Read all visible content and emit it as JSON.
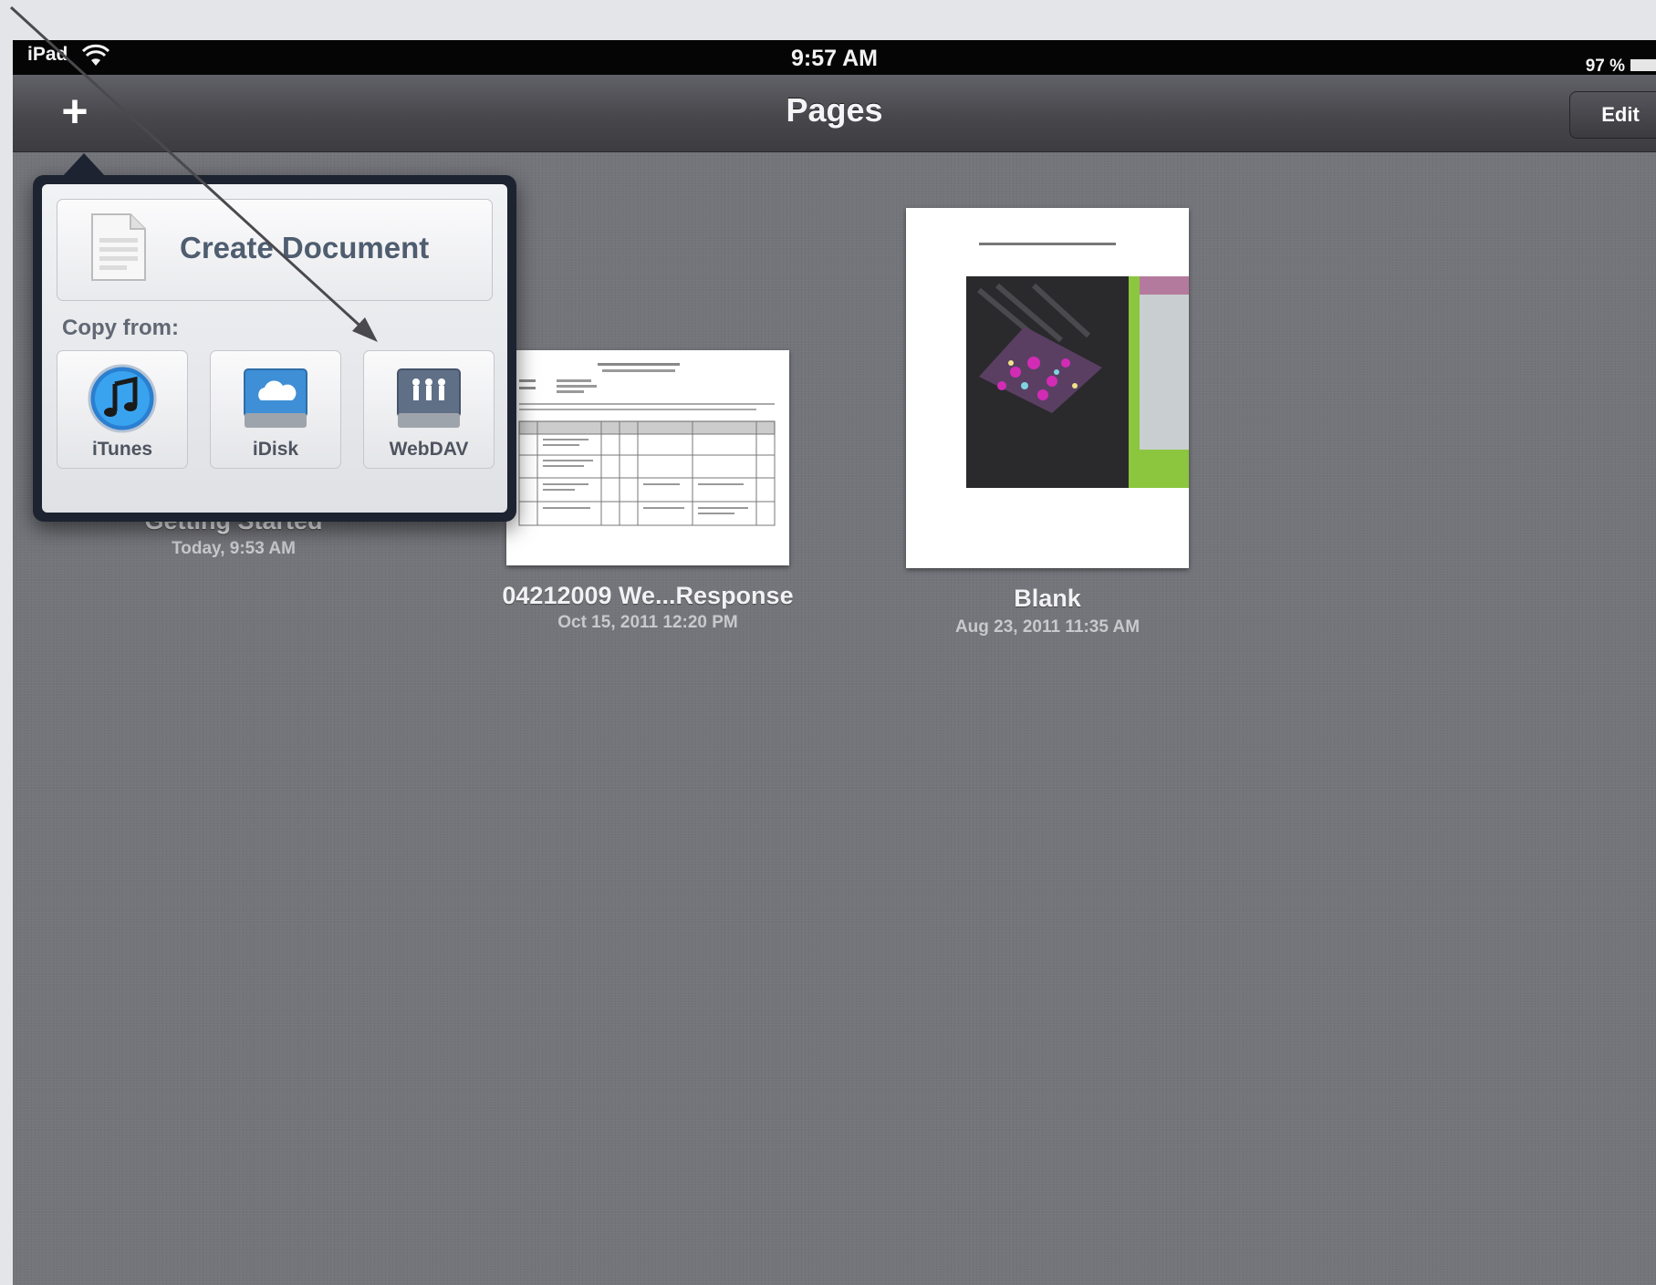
{
  "status_bar": {
    "carrier": "iPad",
    "time": "9:57 AM",
    "battery": "97 %"
  },
  "nav": {
    "title": "Pages",
    "add_label": "+",
    "edit_label": "Edit"
  },
  "popover": {
    "create_label": "Create Document",
    "copy_from_label": "Copy from:",
    "sources": [
      {
        "label": "iTunes",
        "icon": "itunes-icon"
      },
      {
        "label": "iDisk",
        "icon": "idisk-icon"
      },
      {
        "label": "WebDAV",
        "icon": "webdav-icon"
      }
    ]
  },
  "documents": [
    {
      "name": "Getting Started",
      "date": "Today, 9:53 AM"
    },
    {
      "name": "04212009 We...Response",
      "date": "Oct 15, 2011 12:20 PM"
    },
    {
      "name": "Blank",
      "date": "Aug 23, 2011 11:35 AM"
    }
  ],
  "colors": {
    "background": "#74757b",
    "navbar": "#47474c",
    "popover_frame": "#1d2330",
    "accent_green": "#8cc63f"
  }
}
